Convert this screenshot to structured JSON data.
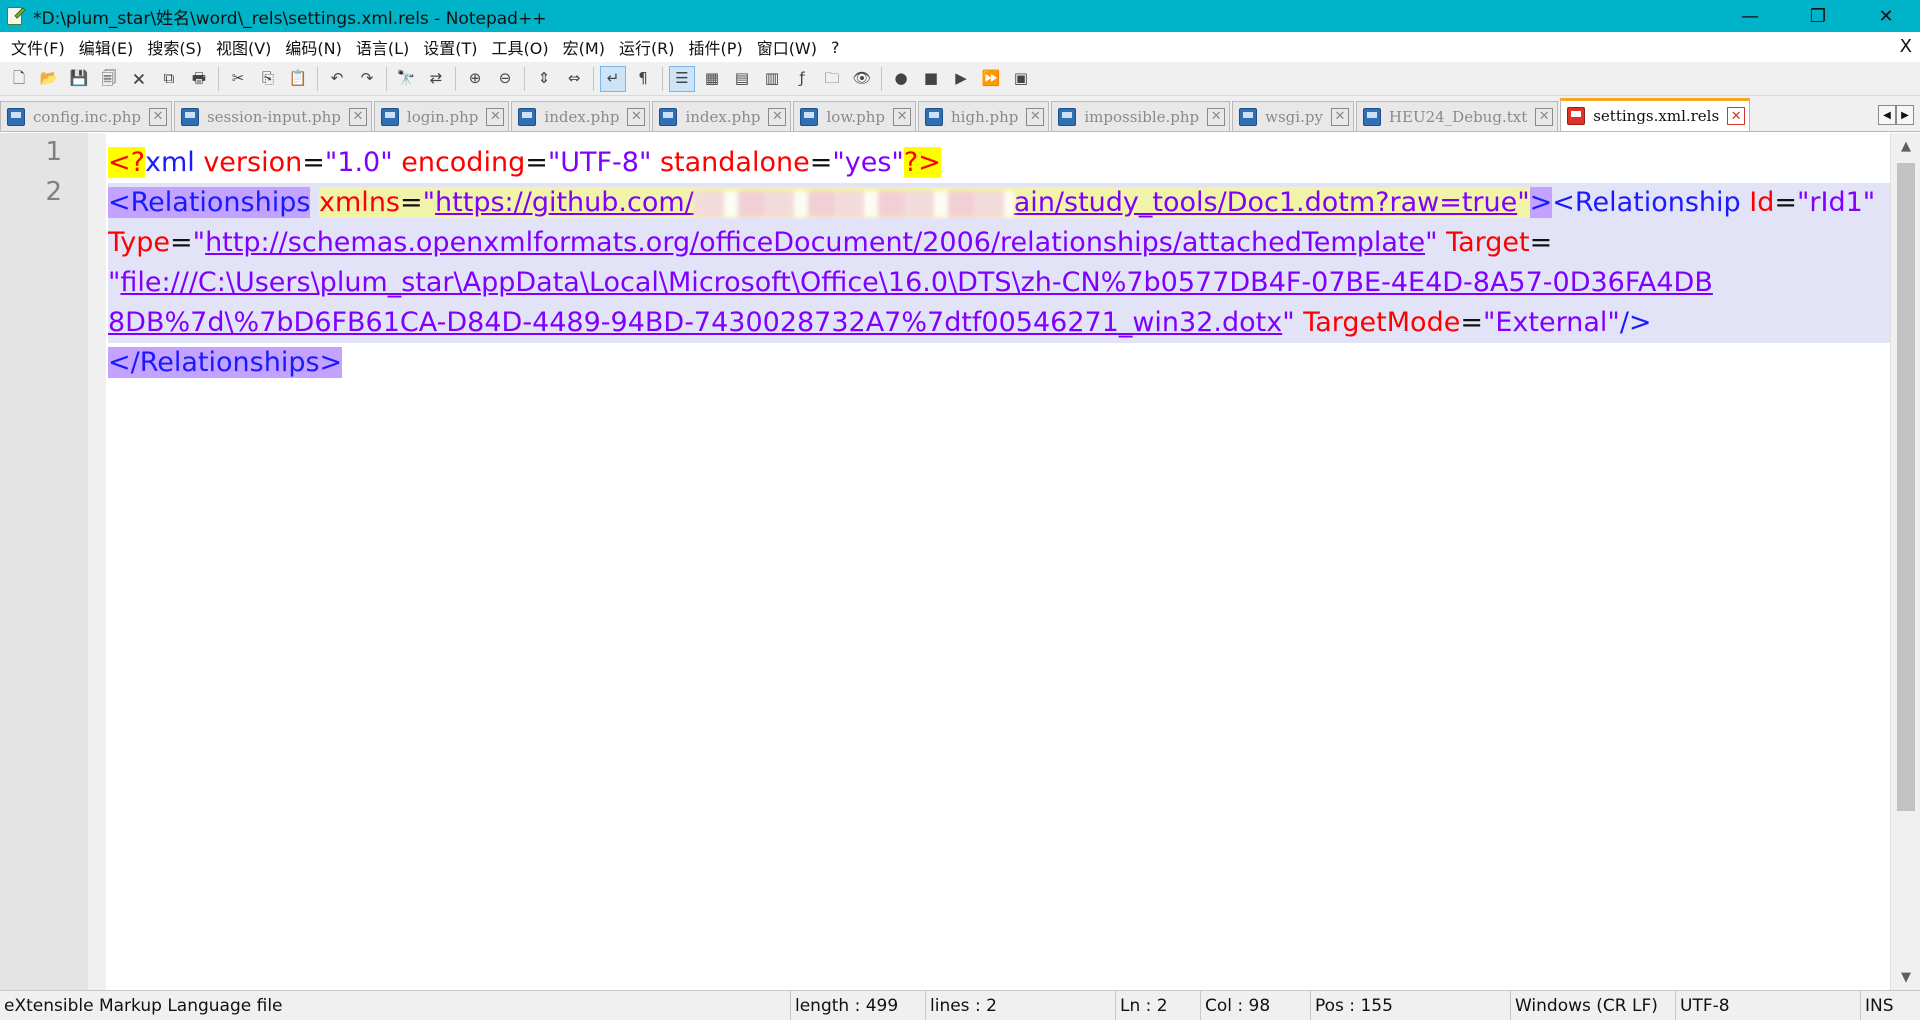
{
  "window": {
    "title": "*D:\\plum_star\\姓名\\word\\_rels\\settings.xml.rels - Notepad++",
    "controls": {
      "minimize": "—",
      "restore": "❐",
      "close": "✕"
    }
  },
  "menu": {
    "items": [
      "文件(F)",
      "编辑(E)",
      "搜索(S)",
      "视图(V)",
      "编码(N)",
      "语言(L)",
      "设置(T)",
      "工具(O)",
      "宏(M)",
      "运行(R)",
      "插件(P)",
      "窗口(W)",
      "?"
    ],
    "close": "X"
  },
  "toolbar": {
    "buttons": [
      {
        "icon": "new-file-icon",
        "glyph": "🗋"
      },
      {
        "icon": "open-file-icon",
        "glyph": "📂"
      },
      {
        "icon": "save-icon",
        "glyph": "💾"
      },
      {
        "icon": "save-all-icon",
        "glyph": "🗐"
      },
      {
        "icon": "close-file-icon",
        "glyph": "🗙"
      },
      {
        "icon": "close-all-icon",
        "glyph": "⧉"
      },
      {
        "icon": "print-icon",
        "glyph": "🖶"
      },
      {
        "icon": "cut-icon",
        "glyph": "✂"
      },
      {
        "icon": "copy-icon",
        "glyph": "⎘"
      },
      {
        "icon": "paste-icon",
        "glyph": "📋"
      },
      {
        "icon": "undo-icon",
        "glyph": "↶"
      },
      {
        "icon": "redo-icon",
        "glyph": "↷"
      },
      {
        "icon": "find-icon",
        "glyph": "🔭"
      },
      {
        "icon": "replace-icon",
        "glyph": "⇄"
      },
      {
        "icon": "zoom-in-icon",
        "glyph": "⊕"
      },
      {
        "icon": "zoom-out-icon",
        "glyph": "⊖"
      },
      {
        "icon": "sync-vertical-icon",
        "glyph": "⇕"
      },
      {
        "icon": "sync-horizontal-icon",
        "glyph": "⇔"
      },
      {
        "icon": "word-wrap-icon",
        "glyph": "↵",
        "active": true
      },
      {
        "icon": "show-all-chars-icon",
        "glyph": "¶"
      },
      {
        "icon": "indent-guide-icon",
        "glyph": "☰",
        "active": true
      },
      {
        "icon": "user-language-icon",
        "glyph": "▦"
      },
      {
        "icon": "doc-map-icon",
        "glyph": "▤"
      },
      {
        "icon": "function-list-icon",
        "glyph": "▥"
      },
      {
        "icon": "folder-workspace-icon",
        "glyph": "ƒ"
      },
      {
        "icon": "folder-icon",
        "glyph": "🗀"
      },
      {
        "icon": "monitor-eye-icon",
        "glyph": "👁"
      },
      {
        "icon": "record-macro-icon",
        "glyph": "●"
      },
      {
        "icon": "stop-macro-icon",
        "glyph": "■"
      },
      {
        "icon": "play-macro-icon",
        "glyph": "▶"
      },
      {
        "icon": "run-macro-multiple-icon",
        "glyph": "⏩"
      },
      {
        "icon": "save-macro-icon",
        "glyph": "▣"
      }
    ]
  },
  "tabs": [
    {
      "label": "config.inc.php",
      "active": false
    },
    {
      "label": "session-input.php",
      "active": false
    },
    {
      "label": "login.php",
      "active": false
    },
    {
      "label": "index.php",
      "active": false
    },
    {
      "label": "index.php",
      "active": false
    },
    {
      "label": "low.php",
      "active": false
    },
    {
      "label": "high.php",
      "active": false
    },
    {
      "label": "impossible.php",
      "active": false
    },
    {
      "label": "wsgi.py",
      "active": false
    },
    {
      "label": "HEU24_Debug.txt",
      "active": false
    },
    {
      "label": "settings.xml.rels",
      "active": true
    }
  ],
  "tab_nav": {
    "prev": "◀",
    "next": "▶"
  },
  "editor": {
    "line_numbers": [
      "1",
      "2"
    ],
    "code": {
      "l1": {
        "open": "<?",
        "name": "xml",
        "a1": " version",
        "eq": "=",
        "v1": "\"1.0\"",
        "a2": " encoding",
        "v2": "\"UTF-8\"",
        "a3": " standalone",
        "v3": "\"yes\"",
        "close": "?>"
      },
      "l2": {
        "tag_open": "<Relationships",
        "space": " ",
        "xmlns": "xmlns",
        "eq": "=",
        "quote": "\"",
        "url_a": "https://github.com/",
        "url_b": "ain/study_tools/Doc1.dotm?raw=true",
        "gt": ">",
        "tag2": "<Relationship",
        "id_attr": " Id",
        "id_val": "\"rId1\"",
        "type_attr": " Type",
        "type_url": "http://schemas.openxmlformats.org/officeDocument/2006/relationships/attachedTemplate",
        "target_attr": " Target",
        "file_url_a": "file:///C:\\Users\\plum_star\\AppData\\Local\\Microsoft\\Office\\16.0\\DTS\\zh-CN%7b0577DB4F-07BE-4E4D-8A57-0D36FA4DB",
        "file_url_b": "8DB%7d\\%7bD6FB61CA-D84D-4489-94BD-7430028732A7%7dtf00546271_win32.dotx",
        "mode_attr": " TargetMode",
        "mode_val": "\"External\"",
        "selfclose": "/>",
        "end_tag": "</Relationships>"
      }
    }
  },
  "scrollbar": {
    "up": "▲",
    "down": "▼"
  },
  "status": {
    "file_type": "eXtensible Markup Language file",
    "length": "length : 499",
    "lines": "lines : 2",
    "ln": "Ln : 2",
    "col": "Col : 98",
    "pos": "Pos : 155",
    "eol": "Windows (CR LF)",
    "encoding": "UTF-8",
    "mode": "INS"
  },
  "colors": {
    "titlebar": "#00b3c8",
    "xml_tag": "#1a1aff",
    "xml_attr": "#ff0000",
    "xml_value": "#8000ff",
    "tag_highlight": "#c3a3ff",
    "pi_highlight": "#ffff00"
  }
}
